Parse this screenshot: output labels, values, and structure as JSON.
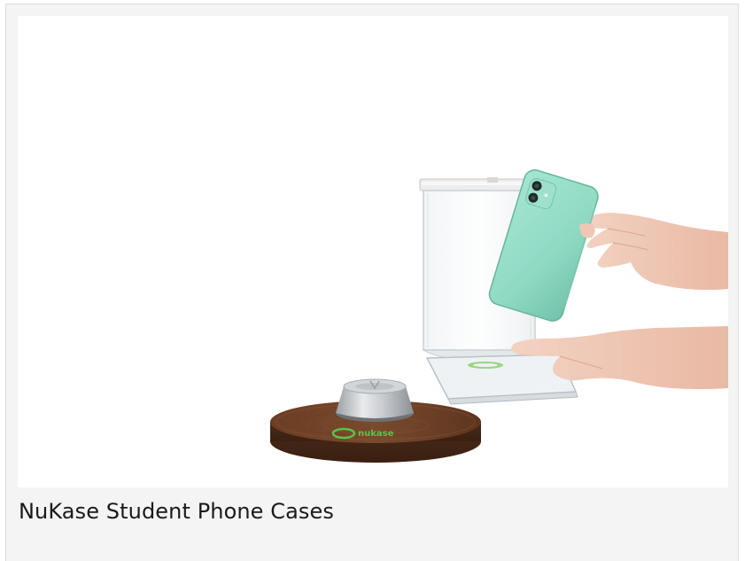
{
  "product_card": {
    "caption": "NuKase Student Phone Cases",
    "image_alt": "Phone being placed into a clear NuKase pouch next to a wooden unlocking base",
    "base_logo_text": "nukase"
  },
  "colors": {
    "card_background": "#f4f4f4",
    "phone_green": "#8fd9c3",
    "wood_base": "#5a3420",
    "logo_green": "#5cc24a"
  }
}
